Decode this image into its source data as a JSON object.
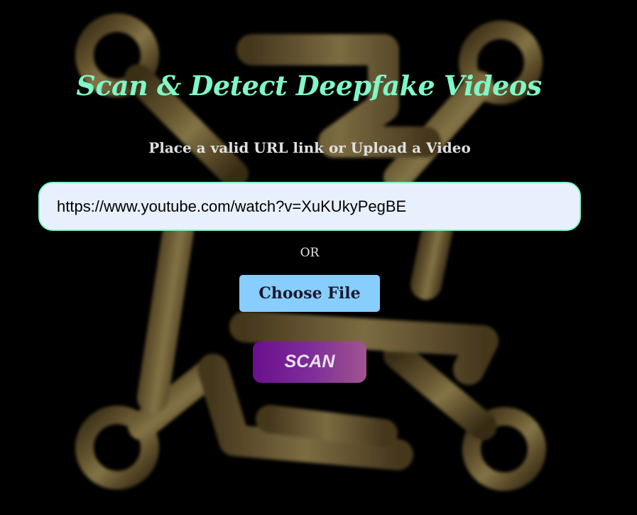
{
  "header": {
    "title": "Scan & Detect Deepfake Videos",
    "subtitle": "Place a valid URL link or Upload a Video"
  },
  "url_input": {
    "value": "https://www.youtube.com/watch?v=XuKUkyPegBE",
    "placeholder": ""
  },
  "divider": {
    "or_label": "OR"
  },
  "file_upload": {
    "button_label": "Choose File"
  },
  "scan": {
    "button_label": "SCAN"
  },
  "colors": {
    "background": "#000000",
    "title": "#7ff7c6",
    "input_border": "#7ff7c6",
    "input_bg": "#e8f0fe",
    "choose_file_bg": "#87ceff",
    "scan_gradient_start": "#6a0f8e",
    "scan_gradient_end": "#a0548f",
    "logo_gold": "#7a6a3e"
  },
  "icons": {
    "background_logo": "circuit-link-logo"
  }
}
